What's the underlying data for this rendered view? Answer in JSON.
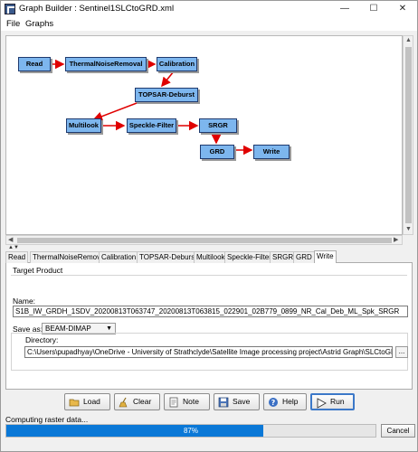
{
  "window": {
    "title": "Graph Builder : Sentinel1SLCtoGRD.xml",
    "minimize": "—",
    "maximize": "☐",
    "close": "✕"
  },
  "menu": [
    "File",
    "Graphs"
  ],
  "graph": {
    "nodes": [
      "Read",
      "ThermalNoiseRemoval",
      "Calibration",
      "TOPSAR-Deburst",
      "Multilook",
      "Speckle-Filter",
      "SRGR",
      "GRD",
      "Write"
    ],
    "colors": {
      "node_fill": "#7db6ee",
      "node_border": "#1f3a6e",
      "edge": "#e00000"
    }
  },
  "tabs": [
    "Read",
    "ThermalNoiseRemoval",
    "Calibration",
    "TOPSAR-Deburst",
    "Multilook",
    "Speckle-Filter",
    "SRGR",
    "GRD",
    "Write"
  ],
  "active_tab": "Write",
  "target": {
    "section": "Target Product",
    "name_label": "Name:",
    "name_value": "S1B_IW_GRDH_1SDV_20200813T063747_20200813T063815_022901_02B779_0899_NR_Cal_Deb_ML_Spk_SRGR",
    "save_as_label": "Save as:",
    "save_as_value": "BEAM-DIMAP",
    "directory_label": "Directory:",
    "directory_value": "C:\\Users\\pupadhyay\\OneDrive - University of Strathclyde\\Satellite Image processing project\\Astrid Graph\\SLCtoGRD",
    "browse": "..."
  },
  "buttons": {
    "load": "Load",
    "clear": "Clear",
    "note": "Note",
    "save": "Save",
    "help": "Help",
    "run": "Run"
  },
  "status": {
    "text": "Computing raster data...",
    "progress_percent": 87,
    "progress_label": "87%",
    "cancel": "Cancel"
  }
}
